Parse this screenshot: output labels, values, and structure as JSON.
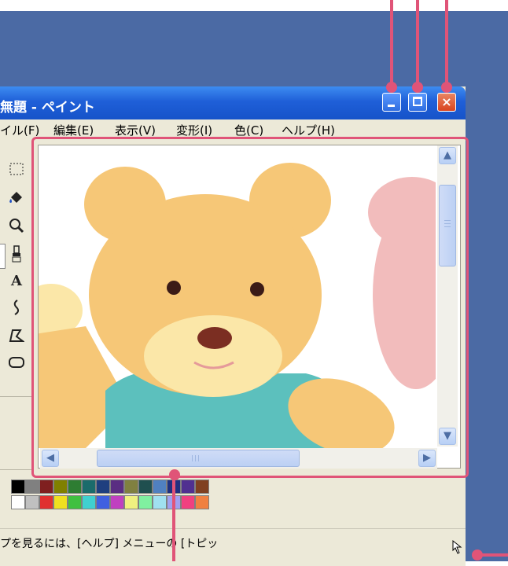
{
  "window": {
    "title": "無題 - ペイント",
    "buttons": {
      "minimize": "minimize",
      "maximize": "maximize",
      "close": "×"
    }
  },
  "menubar": {
    "items": [
      "イル(F)",
      "編集(E)",
      "表示(V)",
      "変形(I)",
      "色(C)",
      "ヘルプ(H)"
    ]
  },
  "toolbox": {
    "tools": [
      "select-rect-icon",
      "fill-bucket-icon",
      "magnifier-icon",
      "brush-icon",
      "text-icon",
      "curve-icon",
      "polygon-icon",
      "rounded-rect-icon"
    ],
    "text_tool_label": "A"
  },
  "palette": {
    "row1": [
      "#000000",
      "#808080",
      "#7f1f1f",
      "#808000",
      "#2e7d32",
      "#1b6b6b",
      "#1f3f7f",
      "#5a2d82",
      "#808040",
      "#1f4f4f",
      "#5080c0",
      "#203080",
      "#503090",
      "#804020"
    ],
    "row2": [
      "#ffffff",
      "#c0c0c0",
      "#e03030",
      "#f0e020",
      "#40c040",
      "#40d0d0",
      "#4060e0",
      "#c040c0",
      "#f0f080",
      "#80f0a0",
      "#a0e0f0",
      "#a0a0f0",
      "#f04080",
      "#f08040"
    ]
  },
  "statusbar": {
    "text": "プを見るには、[ヘルプ] メニューの [トピッ"
  },
  "accent_color": "#e05478",
  "titlebar_color": "#1f5fd8",
  "desktop_color": "#4b6aa4"
}
